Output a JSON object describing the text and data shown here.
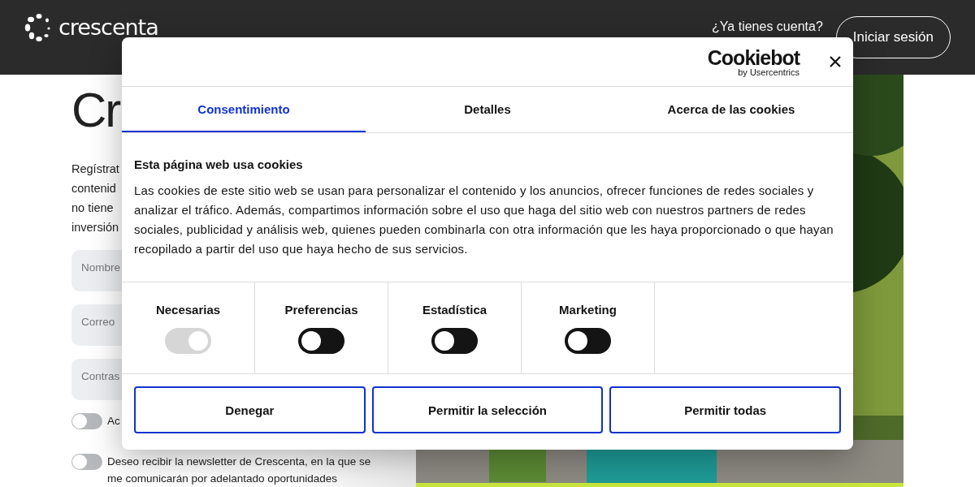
{
  "header": {
    "logo": "crescenta",
    "account_prompt": "¿Ya tienes cuenta?",
    "login_button": "Iniciar sesión"
  },
  "page": {
    "heading": "Cr",
    "intro_lines": [
      "Regístrat",
      "contenid",
      "no tiene",
      "inversión"
    ],
    "fields": [
      {
        "placeholder": "Nombre"
      },
      {
        "placeholder": "Correo"
      },
      {
        "placeholder": "Contras"
      }
    ],
    "consents": [
      {
        "text": "Ac",
        "on": false
      },
      {
        "text": "Deseo recibir la newsletter de Crescenta, en la que se me comunicarán por adelantado oportunidades",
        "on": false
      }
    ]
  },
  "cookie_dialog": {
    "brand": "Cookiebot",
    "brand_sub": "by Usercentrics",
    "tabs": [
      {
        "label": "Consentimiento",
        "selected": true
      },
      {
        "label": "Detalles",
        "selected": false
      },
      {
        "label": "Acerca de las cookies",
        "selected": false
      }
    ],
    "title": "Esta página web usa cookies",
    "body": "Las cookies de este sitio web se usan para personalizar el contenido y los anuncios, ofrecer funciones de redes sociales y analizar el tráfico. Además, compartimos información sobre el uso que haga del sitio web con nuestros partners de redes sociales, publicidad y análisis web, quienes pueden combinarla con otra información que les haya proporcionado o que hayan recopilado a partir del uso que haya hecho de sus servicios.",
    "categories": [
      {
        "label": "Necesarias",
        "checked": true,
        "disabled": true
      },
      {
        "label": "Preferencias",
        "checked": false,
        "disabled": false
      },
      {
        "label": "Estadística",
        "checked": false,
        "disabled": false
      },
      {
        "label": "Marketing",
        "checked": false,
        "disabled": false
      }
    ],
    "buttons": [
      "Denegar",
      "Permitir la selección",
      "Permitir todas"
    ]
  }
}
